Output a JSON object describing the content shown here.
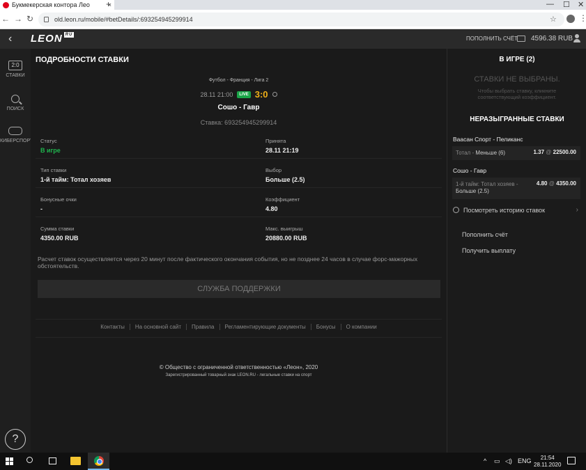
{
  "browser": {
    "tab_title": "Букмекерская контора Лео",
    "tab_close": "×",
    "new_tab": "+",
    "url": "old.leon.ru/mobile/#betDetails/:693254945299914",
    "window_controls": [
      "—",
      "☐",
      "✕"
    ]
  },
  "header": {
    "logo": "LEON",
    "logo_ru": "RU",
    "deposit": "ПОПОЛНИТЬ СЧЁТ",
    "balance": "4596.38 RUB"
  },
  "leftnav": {
    "items": [
      {
        "icon": "2:0",
        "label": "СТАВКИ"
      },
      {
        "icon": "",
        "label": "ПОИСК"
      },
      {
        "icon": "",
        "label": "КИБЕРСПОРТ"
      }
    ],
    "help": "?"
  },
  "bet": {
    "page_title": "ПОДРОБНОСТИ СТАВКИ",
    "league": "Футбол - Франция - Лига 2",
    "datetime": "28.11 21:00",
    "live": "LIVE",
    "score": "3:0",
    "match": "Сошо - Гавр",
    "bet_number": "Ставка: 693254945299914",
    "fields": [
      {
        "label": "Статус",
        "value": "В игре"
      },
      {
        "label": "Принята",
        "value": "28.11 21:19"
      },
      {
        "label": "Тип ставки",
        "value": "1-й тайм: Тотал хозяев"
      },
      {
        "label": "Выбор",
        "value": "Больше (2.5)"
      },
      {
        "label": "Бонусные очки",
        "value": "-"
      },
      {
        "label": "Коэффициент",
        "value": "4.80"
      },
      {
        "label": "Сумма ставки",
        "value": "4350.00 RUB"
      },
      {
        "label": "Макс. выигрыш",
        "value": "20880.00 RUB"
      }
    ],
    "note": "Расчет ставок осуществляется через 20 минут после фактического окончания события, но не позднее 24 часов в случае форс-мажорных обстоятельств.",
    "support_button": "СЛУЖБА ПОДДЕРЖКИ"
  },
  "footer": {
    "links": [
      "Контакты",
      "На основной сайт",
      "Правила",
      "Регламентирующие документы",
      "Бонусы",
      "О компании"
    ],
    "copyright": "© Общество с ограниченной ответственностью «Леон», 2020",
    "trademark": "Зарегистрированный товарный знак LEON.RU - легальные ставки на спорт"
  },
  "right": {
    "in_play": "В ИГРЕ (2)",
    "empty_title": "СТАВКИ НЕ ВЫБРАНЫ.",
    "empty_hint": "Чтобы выбрать ставку, кликните соответствующий коэффициент.",
    "unsettled_title": "НЕРАЗЫГРАННЫЕ СТАВКИ",
    "bets": [
      {
        "match": "Ваасан Спорт - Пеликанс",
        "market": "Тотал -",
        "selection": "Меньше (6)",
        "odds": "1.37",
        "at": "@",
        "amount": "22500.00"
      },
      {
        "match": "Сошо - Гавр",
        "market": "1-й тайм: Тотал хозяев -",
        "selection": "Больше (2.5)",
        "odds": "4.80",
        "at": "@",
        "amount": "4350.00"
      }
    ],
    "history": "Посмотреть историю ставок",
    "links": [
      "Пополнить счёт",
      "Получить выплату"
    ]
  },
  "taskbar": {
    "lang": "ENG",
    "time": "21:54",
    "date": "28.11.2020"
  }
}
